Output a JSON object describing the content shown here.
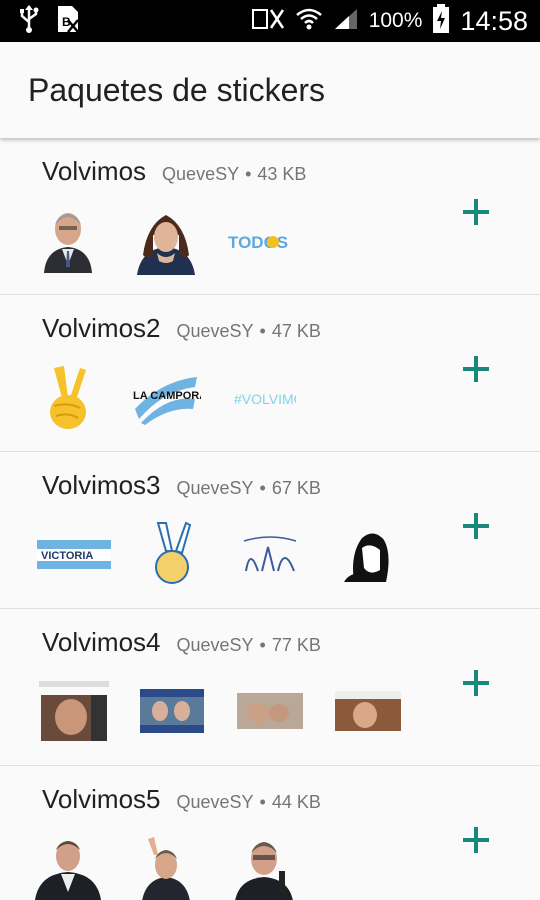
{
  "status_bar": {
    "battery": "100%",
    "time": "14:58"
  },
  "app_bar": {
    "title": "Paquetes de stickers"
  },
  "colors": {
    "accent": "#16897c",
    "status_bar_bg": "#000000"
  },
  "packs": [
    {
      "name": "Volvimos",
      "author": "QueveSY",
      "size": "43 KB",
      "sticker_texts": [
        "",
        "",
        "TODOS"
      ]
    },
    {
      "name": "Volvimos2",
      "author": "QueveSY",
      "size": "47 KB",
      "sticker_texts": [
        "",
        "LA CAMPORA",
        "#VOLVIMOS"
      ]
    },
    {
      "name": "Volvimos3",
      "author": "QueveSY",
      "size": "67 KB",
      "sticker_texts": [
        "VICTORIA",
        "",
        "",
        ""
      ]
    },
    {
      "name": "Volvimos4",
      "author": "QueveSY",
      "size": "77 KB",
      "sticker_texts": [
        "",
        "",
        "",
        ""
      ]
    },
    {
      "name": "Volvimos5",
      "author": "QueveSY",
      "size": "44 KB",
      "sticker_texts": [
        "",
        "",
        ""
      ]
    }
  ]
}
